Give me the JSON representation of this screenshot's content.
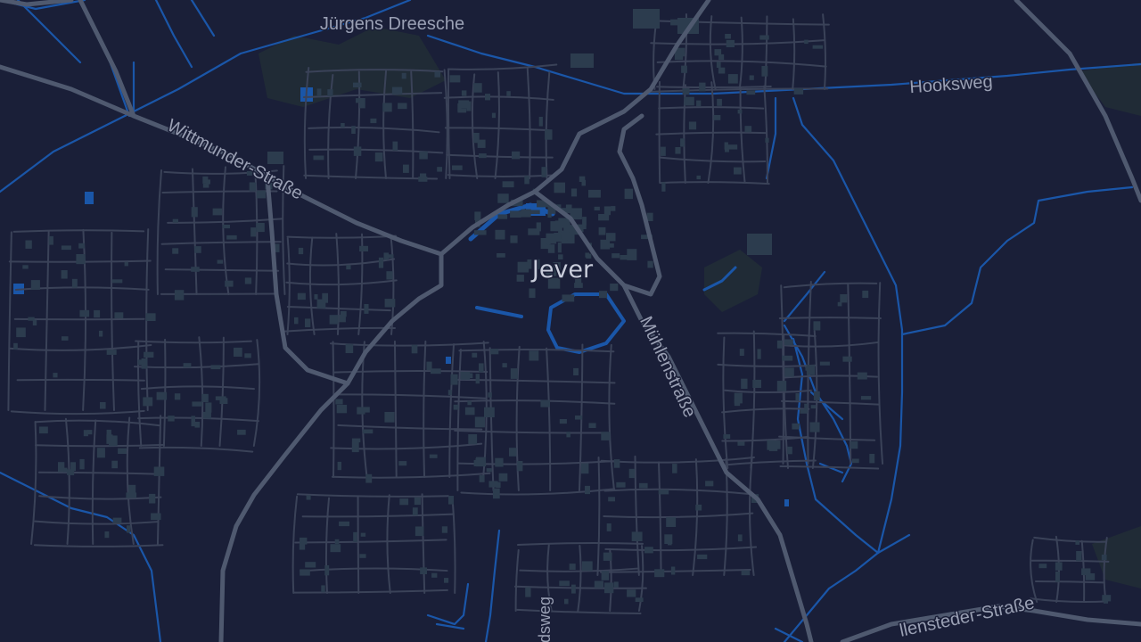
{
  "map": {
    "colors": {
      "background": "#1a1f38",
      "water": "#1a56a8",
      "minor_road": "#3a4258",
      "major_road": "#4f596f",
      "building": "#2c3c4e",
      "park": "#22303a"
    },
    "labels": {
      "town": "Jever",
      "district": "Jürgens Dreesche",
      "street_hooksweg": "Hooksweg",
      "street_wittmunder": "Wittmunder-Straße",
      "street_muehlen": "Mühlenstraße",
      "street_sillenstede": "llenstedeг-Straße",
      "street_bottom": "dsweg"
    }
  }
}
